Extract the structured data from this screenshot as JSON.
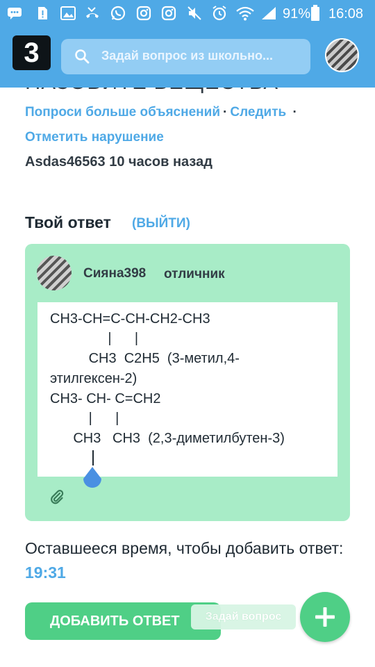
{
  "status_bar": {
    "battery_percent": "91%",
    "time": "16:08"
  },
  "header": {
    "logo_text": "3",
    "search_placeholder": "Задай вопрос из школьно..."
  },
  "question": {
    "title_fragment": "НАЗОВИТЕ ВЕЩЕСТВА",
    "links": {
      "ask_more": "Попроси больше объяснений",
      "follow": "Следить",
      "report": "Отметить нарушение"
    },
    "author": "Asdas46563",
    "time_ago": "10 часов назад"
  },
  "answer": {
    "heading": "Твой ответ",
    "exit_label": "(ВЫЙТИ)",
    "user": {
      "name": "Сияна398",
      "rank": "отличник"
    },
    "editor_lines": [
      "CH3-CH=C-CH-CH2-CH3",
      "               |      |",
      "          CH3  C2H5  (3-метил,4-",
      "этилгексен-2)",
      "CH3- CH- C=CH2",
      "          |      |",
      "      CH3   CH3  (2,3-диметилбутен-3)"
    ]
  },
  "remaining_time": {
    "label": "Оставшееся время, чтобы добавить ответ:",
    "value": "19:31"
  },
  "actions": {
    "add_answer": "ДОБАВИТЬ ОТВЕТ",
    "ask_question_tooltip": "Задай вопрос"
  },
  "colors": {
    "brand_blue": "#4fa9e6",
    "brand_green": "#4fcf86",
    "card_green": "#a8ecc7"
  }
}
